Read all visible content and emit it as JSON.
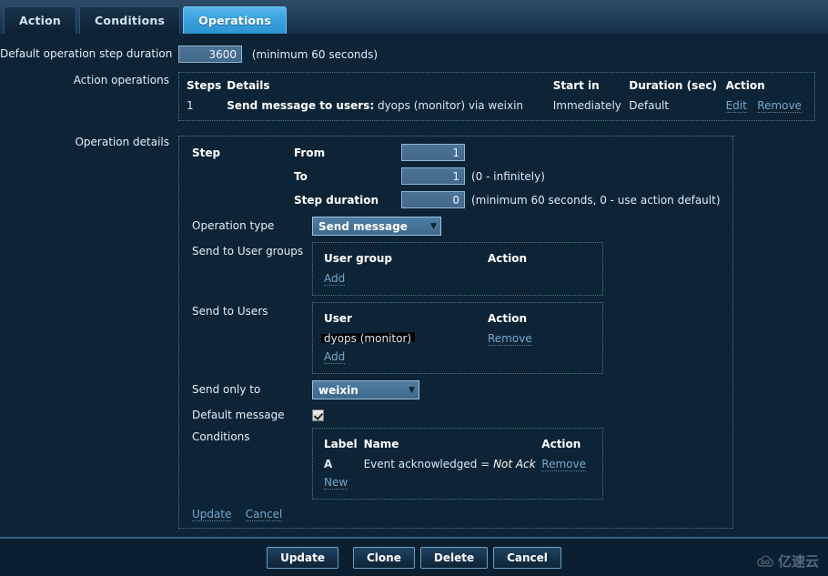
{
  "tabs": [
    {
      "label": "Action",
      "active": false
    },
    {
      "label": "Conditions",
      "active": false
    },
    {
      "label": "Operations",
      "active": true
    }
  ],
  "form": {
    "default_duration_label": "Default operation step duration",
    "default_duration_value": "3600",
    "default_duration_hint": "(minimum 60 seconds)",
    "action_operations_label": "Action operations",
    "operation_details_label": "Operation details"
  },
  "action_operations": {
    "headers": [
      "Steps",
      "Details",
      "Start in",
      "Duration (sec)",
      "Action"
    ],
    "rows": [
      {
        "steps": "1",
        "details_bold": "Send message to users:",
        "details_rest": "dyops (monitor) via weixin",
        "start_in": "Immediately",
        "duration": "Default",
        "action_edit": "Edit",
        "action_remove": "Remove"
      }
    ]
  },
  "details": {
    "step_label": "Step",
    "from_label": "From",
    "from_value": "1",
    "to_label": "To",
    "to_value": "1",
    "to_hint": "(0 - infinitely)",
    "step_duration_label": "Step duration",
    "step_duration_value": "0",
    "step_duration_hint": "(minimum 60 seconds, 0 - use action default)",
    "operation_type_label": "Operation type",
    "operation_type_value": "Send message",
    "send_user_groups_label": "Send to User groups",
    "user_groups_headers": [
      "User group",
      "Action"
    ],
    "user_groups_add": "Add",
    "send_users_label": "Send to Users",
    "users_headers": [
      "User",
      "Action"
    ],
    "users_rows": [
      {
        "user": "dyops (monitor)",
        "redacted": true,
        "action": "Remove"
      }
    ],
    "users_add": "Add",
    "send_only_to_label": "Send only to",
    "send_only_to_value": "weixin",
    "default_message_label": "Default message",
    "default_message_checked": true,
    "conditions_label": "Conditions",
    "conditions_headers": [
      "Label",
      "Name",
      "Action"
    ],
    "conditions_rows": [
      {
        "label": "A",
        "name_prefix": "Event acknowledged = ",
        "name_value": "Not Ack",
        "action": "Remove"
      }
    ],
    "conditions_new": "New",
    "update_link": "Update",
    "cancel_link": "Cancel"
  },
  "footer": {
    "buttons": [
      "Update",
      "Clone",
      "Delete",
      "Cancel"
    ]
  },
  "watermark": {
    "icon": "cloud-icon",
    "text": "亿速云"
  },
  "icons": {
    "caret_down": "▼"
  }
}
